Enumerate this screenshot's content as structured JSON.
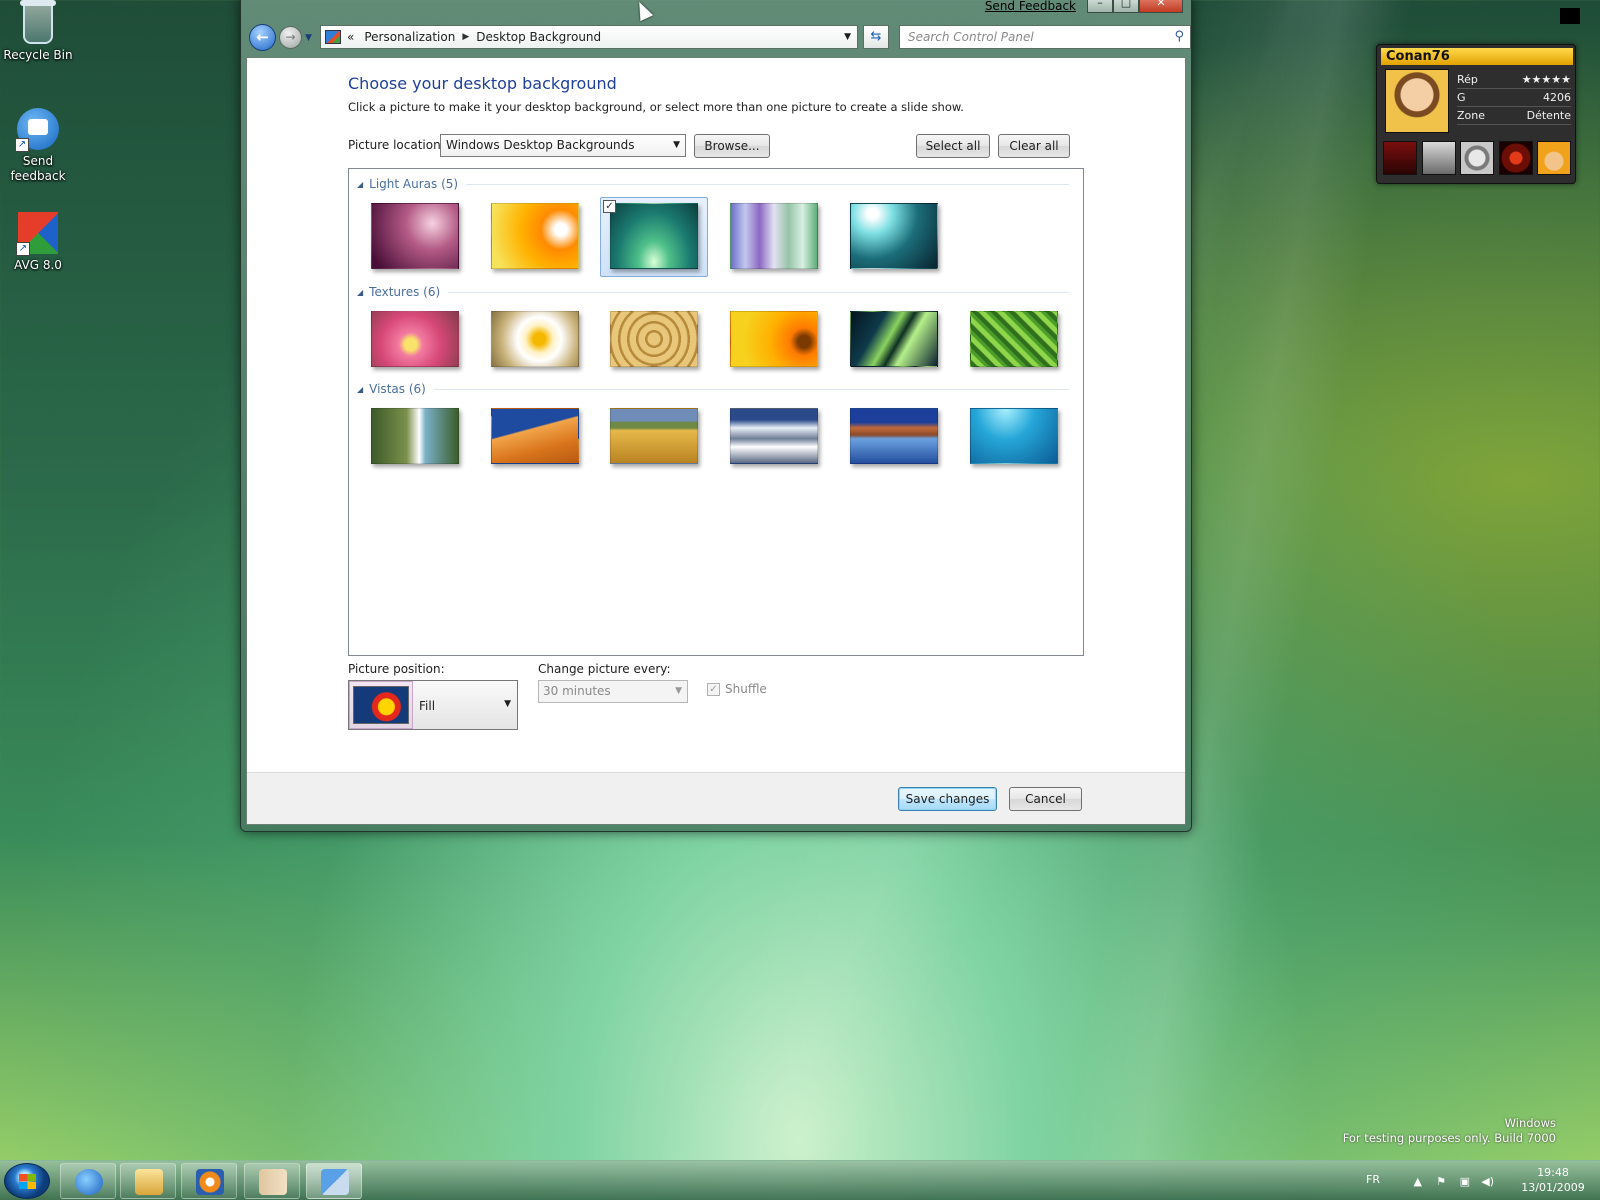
{
  "desktop": {
    "icons": [
      {
        "label": "Recycle Bin"
      },
      {
        "label": "Send\nfeedback"
      },
      {
        "label": "AVG 8.0"
      }
    ]
  },
  "window": {
    "send_feedback": "Send Feedback",
    "caption": {
      "min": "–",
      "max": "□",
      "close": "✕"
    },
    "breadcrumb": {
      "prefix": "«",
      "items": [
        "Personalization",
        "Desktop Background"
      ]
    },
    "search_placeholder": "Search Control Panel",
    "heading": "Choose your desktop background",
    "subtext": "Click a picture to make it your desktop background, or select more than one picture to create a slide show.",
    "picture_location_label": "Picture location:",
    "picture_location_value": "Windows Desktop Backgrounds",
    "browse_label": "Browse...",
    "select_all_label": "Select all",
    "clear_all_label": "Clear all",
    "groups": [
      {
        "name": "Light Auras (5)",
        "count": 5,
        "selected_index": 2,
        "thumbs": [
          "aura-pink",
          "aura-yellow",
          "aura-green",
          "aura-stripes",
          "aura-teal"
        ]
      },
      {
        "name": "Textures (6)",
        "count": 6,
        "thumbs": [
          "dahlia",
          "frangipani",
          "honeycomb",
          "gerbera",
          "leaves",
          "fern"
        ]
      },
      {
        "name": "Vistas (6)",
        "count": 6,
        "thumbs": [
          "waterfall",
          "dunes",
          "wheat",
          "mountains",
          "lake",
          "underwater"
        ]
      }
    ],
    "picture_position_label": "Picture position:",
    "picture_position_value": "Fill",
    "change_every_label": "Change picture every:",
    "change_every_value": "30 minutes",
    "shuffle_label": "Shuffle",
    "save_label": "Save changes",
    "cancel_label": "Cancel"
  },
  "gadget": {
    "username": "Conan76",
    "rows": [
      {
        "key": "Rép",
        "value": "★★★★★"
      },
      {
        "key": "G",
        "value": "4206"
      },
      {
        "key": "Zone",
        "value": "Détente"
      }
    ]
  },
  "taskbar": {
    "lang": "FR",
    "time": "19:48",
    "date": "13/01/2009",
    "watermark_line1": "Windows",
    "watermark_line2": "For testing purposes only. Build 7000"
  }
}
